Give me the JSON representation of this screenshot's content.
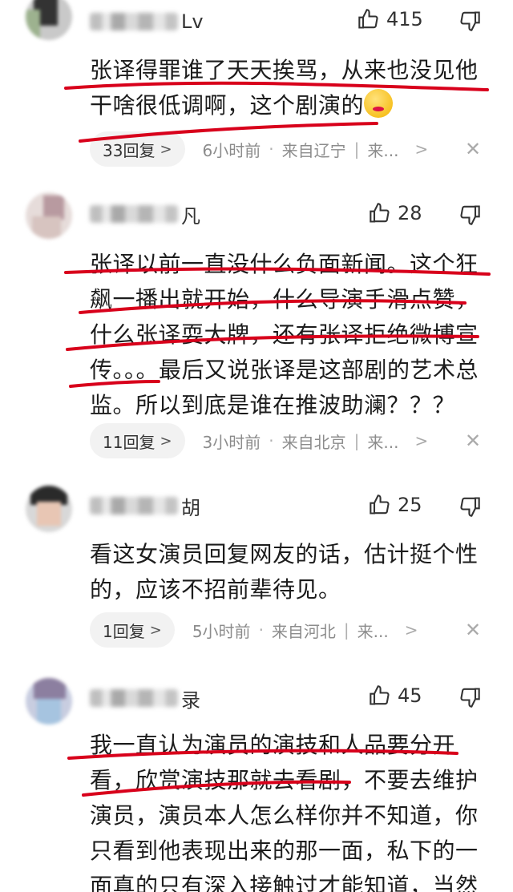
{
  "comments": [
    {
      "username_tail": "Lv",
      "likes": "415",
      "text": "张译得罪谁了天天挨骂，从来也没见他干啥很低调啊，这个剧演的",
      "reply_count": "33回复",
      "time": "6小时前",
      "location": "来自辽宁",
      "more": "来..."
    },
    {
      "username_tail": "凡",
      "likes": "28",
      "text": "张译以前一直没什么负面新闻。这个狂飙一播出就开始，什么导演手滑点赞，什么张译耍大牌，还有张译拒绝微博宣传。。。最后又说张译是这部剧的艺术总监。所以到底是谁在推波助澜？？？",
      "reply_count": "11回复",
      "time": "3小时前",
      "location": "来自北京",
      "more": "来..."
    },
    {
      "username_tail": "胡",
      "likes": "25",
      "text": "看这女演员回复网友的话，估计挺个性的，应该不招前辈待见。",
      "reply_count": "1回复",
      "time": "5小时前",
      "location": "来自河北",
      "more": "来..."
    },
    {
      "username_tail": "录",
      "likes": "45",
      "text": "我一直认为演员的演技和人品要分开看，欣赏演技那就去看剧，不要去维护演员，演员本人怎么样你并不知道，你只看到他表现出来的那一面，私下的一面真的只有深入接触过才能知道，当然"
    }
  ],
  "icons": {
    "like": "thumbs-up-icon",
    "dislike": "thumbs-down-icon",
    "close": "close-icon",
    "chevron": "chevron-right-icon"
  },
  "colors": {
    "annotation_red": "#d8001b",
    "meta_gray": "#8c8c8c",
    "pill_bg": "#f2f2f2"
  },
  "ui": {
    "separator": "|",
    "dot": "·",
    "chevron": ">",
    "close": "✕"
  }
}
